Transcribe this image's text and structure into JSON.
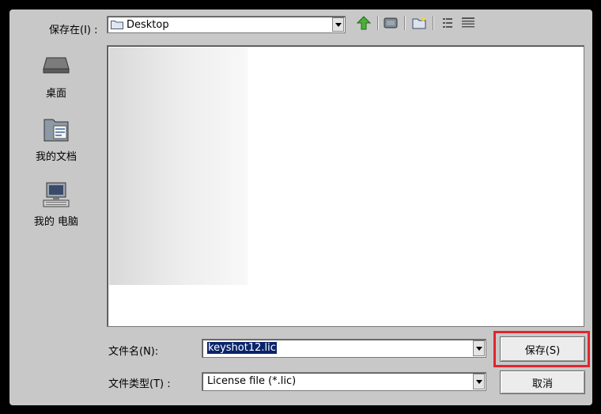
{
  "dialog": {
    "save_in_label": "保存在(I) :",
    "location_value": "Desktop",
    "toolbar": {
      "up_icon": "up-arrow-icon",
      "desktop_icon": "desktop-icon",
      "new_folder_icon": "new-folder-icon",
      "list_view_icon": "list-view-icon",
      "details_view_icon": "details-view-icon"
    },
    "places": [
      {
        "label": "桌面",
        "icon": "desktop-icon"
      },
      {
        "label": "我的文档",
        "icon": "documents-folder-icon"
      },
      {
        "label": "我的 电脑",
        "icon": "computer-icon"
      }
    ],
    "filename_label": "文件名(N):",
    "filename_value": "keyshot12.lic",
    "filetype_label": "文件类型(T) :",
    "filetype_value": "License file (*.lic)",
    "save_button": "保存(S)",
    "cancel_button": "取消",
    "highlight_color": "#e0262f"
  }
}
